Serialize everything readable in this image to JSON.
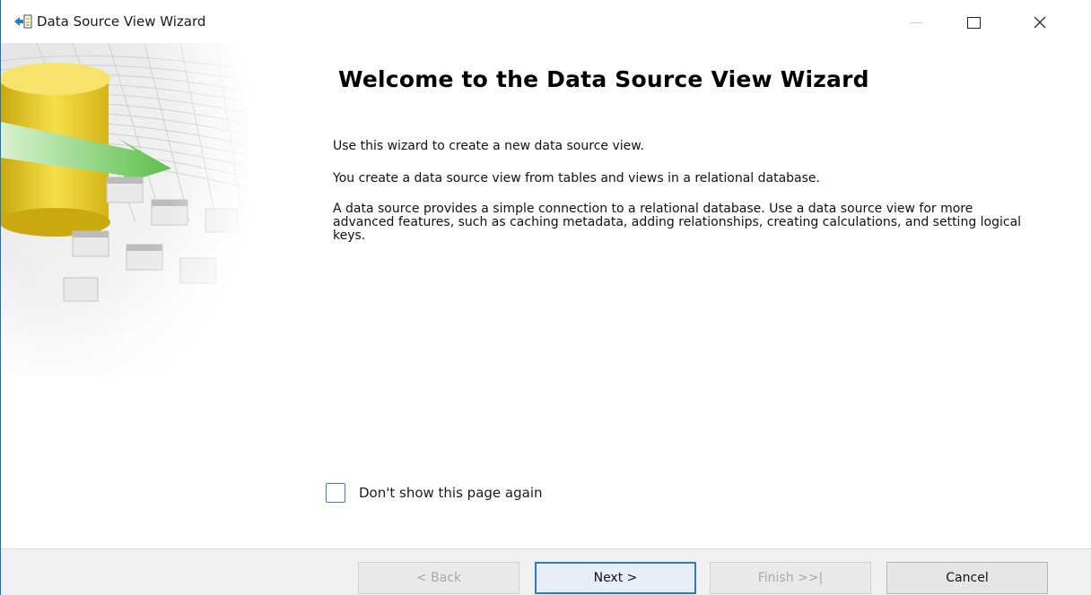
{
  "window": {
    "title": "Data Source View Wizard",
    "minimize_glyph": "—",
    "maximize_glyph": "☐",
    "close_glyph": "✕"
  },
  "content": {
    "heading": "Welcome to the Data Source View Wizard",
    "paragraph_1": "Use this wizard to create a new data source view.",
    "paragraph_2": "You create a data source view from tables and views in a relational database.",
    "paragraph_3": "A data source provides a simple connection to a relational database. Use a data source view for more advanced features, such as caching metadata, adding relationships, creating calculations, and setting logical keys.",
    "checkbox_label": "Don't show this page again",
    "checkbox_checked": false
  },
  "buttons": {
    "back": "< Back",
    "next": "Next >",
    "finish": "Finish >>|",
    "cancel": "Cancel"
  },
  "colors": {
    "accent": "#2a7ad2",
    "cylinder": "#e8c520",
    "arrow": "#7dd36a"
  },
  "icons": {
    "app": "data-source-view-wizard-icon",
    "side": "database-cylinder-illustration"
  }
}
